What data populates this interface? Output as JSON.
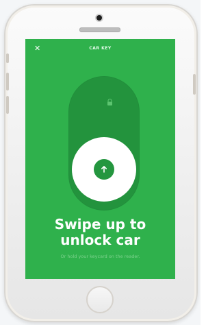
{
  "header": {
    "close_icon": "close-icon",
    "title": "CAR KEY"
  },
  "slider": {
    "lock_icon": "lock-icon",
    "arrow_icon": "arrow-up-icon"
  },
  "main": {
    "headline_line1": "Swipe up to",
    "headline_line2": "unlock car",
    "subtext": "Or hold your keycard on the reader."
  },
  "colors": {
    "accent": "#2fb14c",
    "track": "#23933d",
    "knob": "#ffffff"
  }
}
